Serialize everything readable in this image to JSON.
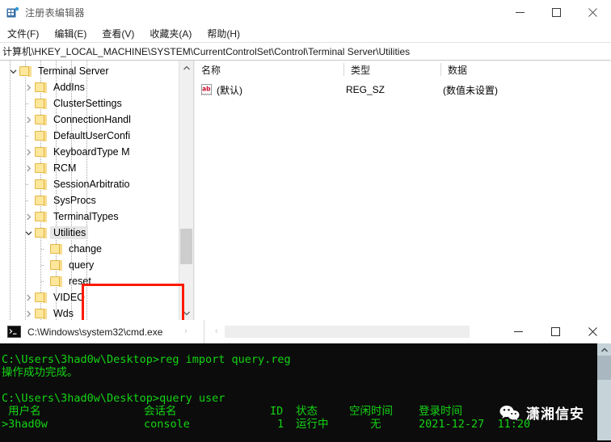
{
  "regedit": {
    "window_title": "注册表编辑器",
    "title_icon": "registry-editor-icon",
    "window_buttons": {
      "minimize": "—",
      "maximize": "☐",
      "close": "✕"
    },
    "menu": [
      {
        "label": "文件(F)",
        "accel": "F"
      },
      {
        "label": "编辑(E)",
        "accel": "E"
      },
      {
        "label": "查看(V)",
        "accel": "V"
      },
      {
        "label": "收藏夹(A)",
        "accel": "A"
      },
      {
        "label": "帮助(H)",
        "accel": "H"
      }
    ],
    "address": "计算机\\HKEY_LOCAL_MACHINE\\SYSTEM\\CurrentControlSet\\Control\\Terminal Server\\Utilities",
    "tree": [
      {
        "label": "Terminal Server",
        "depth": 3,
        "expander": "expanded",
        "selected": false
      },
      {
        "label": "AddIns",
        "depth": 4,
        "expander": "collapsed",
        "selected": false
      },
      {
        "label": "ClusterSettings",
        "depth": 4,
        "expander": "none",
        "selected": false
      },
      {
        "label": "ConnectionHandl",
        "depth": 4,
        "expander": "collapsed",
        "selected": false
      },
      {
        "label": "DefaultUserConfi",
        "depth": 4,
        "expander": "none",
        "selected": false
      },
      {
        "label": "KeyboardType M",
        "depth": 4,
        "expander": "collapsed",
        "selected": false
      },
      {
        "label": "RCM",
        "depth": 4,
        "expander": "collapsed",
        "selected": false
      },
      {
        "label": "SessionArbitratio",
        "depth": 4,
        "expander": "none",
        "selected": false
      },
      {
        "label": "SysProcs",
        "depth": 4,
        "expander": "none",
        "selected": false
      },
      {
        "label": "TerminalTypes",
        "depth": 4,
        "expander": "collapsed",
        "selected": false
      },
      {
        "label": "Utilities",
        "depth": 4,
        "expander": "expanded",
        "selected": true
      },
      {
        "label": "change",
        "depth": 5,
        "expander": "none",
        "selected": false
      },
      {
        "label": "query",
        "depth": 5,
        "expander": "none",
        "selected": false
      },
      {
        "label": "reset",
        "depth": 5,
        "expander": "none",
        "selected": false
      },
      {
        "label": "VIDEO",
        "depth": 4,
        "expander": "collapsed",
        "selected": false
      },
      {
        "label": "Wds",
        "depth": 4,
        "expander": "collapsed",
        "selected": false
      }
    ],
    "highlight_color": "#ff1a00",
    "values_columns": [
      {
        "label": "名称"
      },
      {
        "label": "类型"
      },
      {
        "label": "数据"
      }
    ],
    "values_rows": [
      {
        "icon": "string-value-icon",
        "name": "(默认)",
        "type": "REG_SZ",
        "data": "(数值未设置)"
      }
    ]
  },
  "cmd": {
    "window_title": "C:\\Windows\\system32\\cmd.exe",
    "title_icon": "console-icon",
    "window_buttons": {
      "minimize": "—",
      "maximize": "☐",
      "close": "✕"
    },
    "text_color": "#14d414",
    "background_color": "#0c0c0c",
    "lines": [
      {
        "text": "C:\\Users\\3had0w\\Desktop>reg import query.reg"
      },
      {
        "text": "操作成功完成。"
      },
      {
        "text": ""
      },
      {
        "text": "C:\\Users\\3had0w\\Desktop>query user"
      }
    ],
    "query_user_table": {
      "headers": [
        {
          "label": " 用户名"
        },
        {
          "label": "会话名"
        },
        {
          "label": "ID"
        },
        {
          "label": "状态"
        },
        {
          "label": "空闲时间"
        },
        {
          "label": "登录时间"
        }
      ],
      "rows": [
        {
          "username": ">3had0w",
          "session": "console",
          "id": "1",
          "state": "运行中",
          "idle": "无",
          "logon_time": "2021-12-27  11:20"
        }
      ]
    }
  },
  "watermark": {
    "logo": "wechat-icon",
    "text": "潇湘信安"
  }
}
